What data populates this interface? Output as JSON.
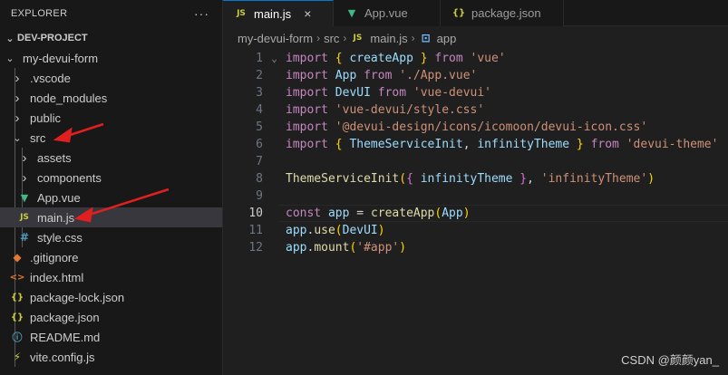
{
  "sidebar": {
    "title": "EXPLORER",
    "more": "···",
    "project": "DEV-PROJECT",
    "items": [
      {
        "label": "my-devui-form",
        "kind": "folder-open",
        "depth": 1
      },
      {
        "label": ".vscode",
        "kind": "folder",
        "depth": 2
      },
      {
        "label": "node_modules",
        "kind": "folder",
        "depth": 2
      },
      {
        "label": "public",
        "kind": "folder",
        "depth": 2
      },
      {
        "label": "src",
        "kind": "folder-open",
        "depth": 2
      },
      {
        "label": "assets",
        "kind": "folder",
        "depth": 3
      },
      {
        "label": "components",
        "kind": "folder",
        "depth": 3
      },
      {
        "label": "App.vue",
        "kind": "vue",
        "depth": 3
      },
      {
        "label": "main.js",
        "kind": "js",
        "depth": 3
      },
      {
        "label": "style.css",
        "kind": "css",
        "depth": 3
      },
      {
        "label": ".gitignore",
        "kind": "git",
        "depth": 2
      },
      {
        "label": "index.html",
        "kind": "html",
        "depth": 2
      },
      {
        "label": "package-lock.json",
        "kind": "json",
        "depth": 2
      },
      {
        "label": "package.json",
        "kind": "json",
        "depth": 2
      },
      {
        "label": "README.md",
        "kind": "info",
        "depth": 2
      },
      {
        "label": "vite.config.js",
        "kind": "vite",
        "depth": 2
      }
    ]
  },
  "icons": {
    "js": "JS",
    "vue": "▼",
    "css": "#",
    "git": "◆",
    "html": "<>",
    "json": "{}",
    "info": "ⓘ",
    "vite": "⚡",
    "chevron_right": "›",
    "chevron_down": "⌄",
    "close": "×",
    "fold": "⌄",
    "app_symbol": "⊡"
  },
  "tabs": [
    {
      "label": "main.js",
      "icon": "js",
      "active": true
    },
    {
      "label": "App.vue",
      "icon": "vue",
      "active": false
    },
    {
      "label": "package.json",
      "icon": "json",
      "active": false
    }
  ],
  "breadcrumb": {
    "parts": [
      "my-devui-form",
      "src",
      "main.js",
      "app"
    ],
    "sep": "›"
  },
  "code": {
    "lines": [
      {
        "n": "1",
        "tokens": [
          [
            "kw",
            "import"
          ],
          [
            "pl",
            " "
          ],
          [
            "br",
            "{"
          ],
          [
            "pl",
            " "
          ],
          [
            "id",
            "createApp"
          ],
          [
            "pl",
            " "
          ],
          [
            "br",
            "}"
          ],
          [
            "pl",
            " "
          ],
          [
            "kw",
            "from"
          ],
          [
            "pl",
            " "
          ],
          [
            "str",
            "'vue'"
          ]
        ]
      },
      {
        "n": "2",
        "tokens": [
          [
            "kw",
            "import"
          ],
          [
            "pl",
            " "
          ],
          [
            "id",
            "App"
          ],
          [
            "pl",
            " "
          ],
          [
            "kw",
            "from"
          ],
          [
            "pl",
            " "
          ],
          [
            "str",
            "'./App.vue'"
          ]
        ]
      },
      {
        "n": "3",
        "tokens": [
          [
            "kw",
            "import"
          ],
          [
            "pl",
            " "
          ],
          [
            "id",
            "DevUI"
          ],
          [
            "pl",
            " "
          ],
          [
            "kw",
            "from"
          ],
          [
            "pl",
            " "
          ],
          [
            "str",
            "'vue-devui'"
          ]
        ]
      },
      {
        "n": "4",
        "tokens": [
          [
            "kw",
            "import"
          ],
          [
            "pl",
            " "
          ],
          [
            "str",
            "'vue-devui/style.css'"
          ]
        ]
      },
      {
        "n": "5",
        "tokens": [
          [
            "kw",
            "import"
          ],
          [
            "pl",
            " "
          ],
          [
            "str",
            "'@devui-design/icons/icomoon/devui-icon.css'"
          ]
        ]
      },
      {
        "n": "6",
        "tokens": [
          [
            "kw",
            "import"
          ],
          [
            "pl",
            " "
          ],
          [
            "br",
            "{"
          ],
          [
            "pl",
            " "
          ],
          [
            "id",
            "ThemeServiceInit"
          ],
          [
            "pl",
            ", "
          ],
          [
            "id",
            "infinityTheme"
          ],
          [
            "pl",
            " "
          ],
          [
            "br",
            "}"
          ],
          [
            "pl",
            " "
          ],
          [
            "kw",
            "from"
          ],
          [
            "pl",
            " "
          ],
          [
            "str",
            "'devui-theme'"
          ]
        ]
      },
      {
        "n": "7",
        "tokens": []
      },
      {
        "n": "8",
        "tokens": [
          [
            "fn",
            "ThemeServiceInit"
          ],
          [
            "br",
            "("
          ],
          [
            "br2",
            "{"
          ],
          [
            "pl",
            " "
          ],
          [
            "id",
            "infinityTheme"
          ],
          [
            "pl",
            " "
          ],
          [
            "br2",
            "}"
          ],
          [
            "pl",
            ", "
          ],
          [
            "str",
            "'infinityTheme'"
          ],
          [
            "br",
            ")"
          ]
        ]
      },
      {
        "n": "9",
        "tokens": []
      },
      {
        "n": "10",
        "tokens": [
          [
            "kw",
            "const"
          ],
          [
            "pl",
            " "
          ],
          [
            "id",
            "app"
          ],
          [
            "pl",
            " = "
          ],
          [
            "fn",
            "createApp"
          ],
          [
            "br",
            "("
          ],
          [
            "id",
            "App"
          ],
          [
            "br",
            ")"
          ]
        ]
      },
      {
        "n": "11",
        "tokens": [
          [
            "id",
            "app"
          ],
          [
            "pl",
            "."
          ],
          [
            "fn",
            "use"
          ],
          [
            "br",
            "("
          ],
          [
            "id",
            "DevUI"
          ],
          [
            "br",
            ")"
          ]
        ]
      },
      {
        "n": "12",
        "tokens": [
          [
            "id",
            "app"
          ],
          [
            "pl",
            "."
          ],
          [
            "fn",
            "mount"
          ],
          [
            "br",
            "("
          ],
          [
            "str",
            "'#app'"
          ],
          [
            "br",
            ")"
          ]
        ]
      }
    ],
    "current_line": "10"
  },
  "watermark": "CSDN @颜颜yan_",
  "colors": {
    "arrow": "#e02020",
    "accent": "#0078d4"
  }
}
